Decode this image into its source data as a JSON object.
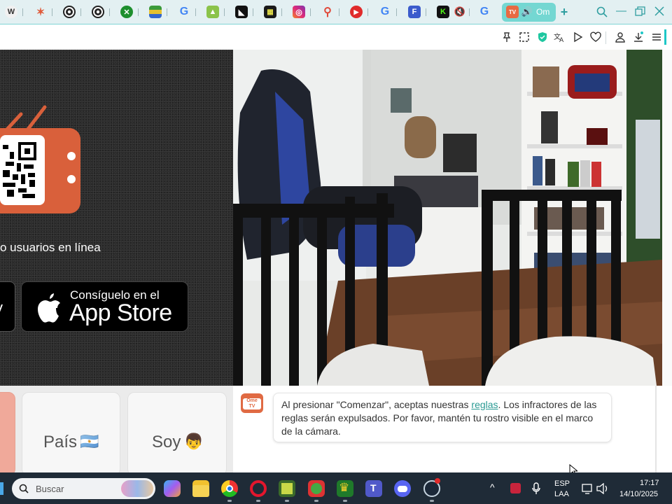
{
  "browser": {
    "active_tab_label": "Om",
    "tab_icons": [
      "wikipedia-icon",
      "star-logo-icon",
      "chrome-icon",
      "chrome-icon",
      "xbox-icon",
      "layers-icon",
      "google-icon",
      "image-icon",
      "sparkle-icon",
      "grid-logo-icon",
      "instagram-icon",
      "maps-icon",
      "youtube-music-icon",
      "google-icon",
      "flipboard-icon",
      "kick-icon",
      "mute-icon",
      "google-icon",
      "ome-tv-icon",
      "speaker-icon",
      "new-tab-icon"
    ],
    "window_buttons": [
      "search-tabs-icon",
      "minimize-icon",
      "restore-icon",
      "close-icon"
    ],
    "toolbar_icons": [
      "pin-icon",
      "screenshot-icon",
      "shield-icon",
      "translate-icon",
      "play-icon",
      "heart-icon",
      "profile-icon",
      "download-icon",
      "menu-icon"
    ],
    "accent_color": "#74d7d2"
  },
  "promo": {
    "online_text": "o usuarios en línea",
    "appstore_small": "Consíguelo en el",
    "appstore_big": "App Store",
    "tv_color": "#d9603b"
  },
  "cards": [
    {
      "label": "País",
      "emoji": "🇦🇷"
    },
    {
      "label": "Soy",
      "emoji": "👦"
    }
  ],
  "chat": {
    "message_before_link": "Al presionar \"Comenzar\", aceptas nuestras ",
    "link_text": "reglas",
    "message_after_link": ". Los infractores de las reglas serán expulsados. Por favor, mantén tu rostro visible en el marco de la cámara.",
    "avatar_label": "Ome TV"
  },
  "taskbar": {
    "search_placeholder": "Buscar",
    "apps": [
      "copilot-icon",
      "file-explorer-icon",
      "chrome-icon",
      "opera-icon",
      "game-icon",
      "photos-icon",
      "crown-game-icon",
      "teams-icon",
      "discord-icon",
      "steam-icon"
    ],
    "lang_top": "ESP",
    "lang_bottom": "LAA",
    "time": "17:17",
    "date": "14/10/2025"
  }
}
